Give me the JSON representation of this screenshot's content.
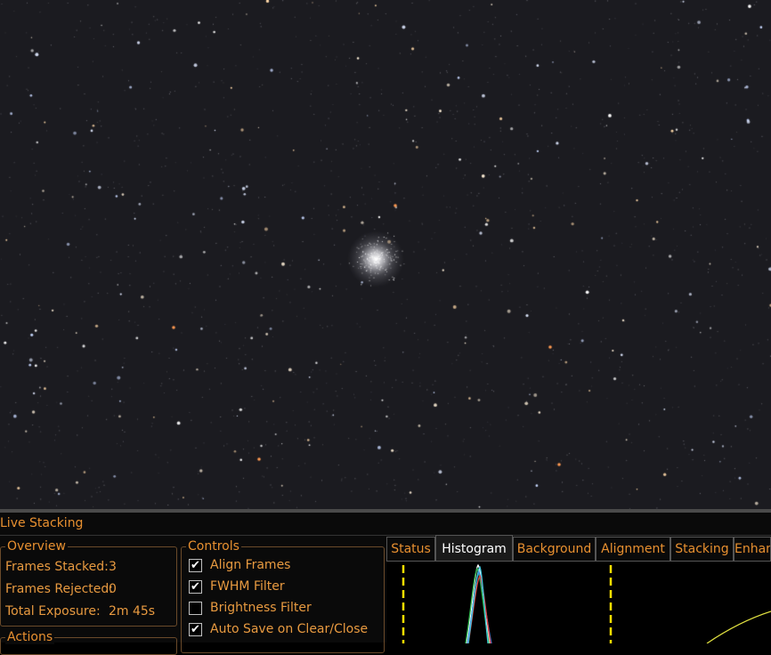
{
  "image_view": {
    "description_icon": "star-field-image"
  },
  "panel": {
    "title": "Live Stacking"
  },
  "overview": {
    "legend": "Overview",
    "frames_stacked_label": "Frames Stacked:",
    "frames_stacked_value": "3",
    "frames_rejected_label": "Frames Rejected:",
    "frames_rejected_value": "0",
    "total_exposure_label": "Total Exposure:",
    "total_exposure_value": "2m 45s"
  },
  "actions": {
    "legend": "Actions"
  },
  "controls": {
    "legend": "Controls",
    "items": [
      {
        "label": "Align Frames",
        "checked": true
      },
      {
        "label": "FWHM Filter",
        "checked": true
      },
      {
        "label": "Brightness Filter",
        "checked": false
      },
      {
        "label": "Auto Save on Clear/Close",
        "checked": true
      }
    ]
  },
  "tabs": [
    {
      "label": "Status",
      "active": false
    },
    {
      "label": "Histogram",
      "active": true
    },
    {
      "label": "Background",
      "active": false
    },
    {
      "label": "Alignment",
      "active": false
    },
    {
      "label": "Stacking",
      "active": false
    },
    {
      "label": "Enhan",
      "active": false
    }
  ],
  "colors": {
    "accent": "#e89030",
    "marker": "#ffe000",
    "curve": "#e0e040"
  }
}
